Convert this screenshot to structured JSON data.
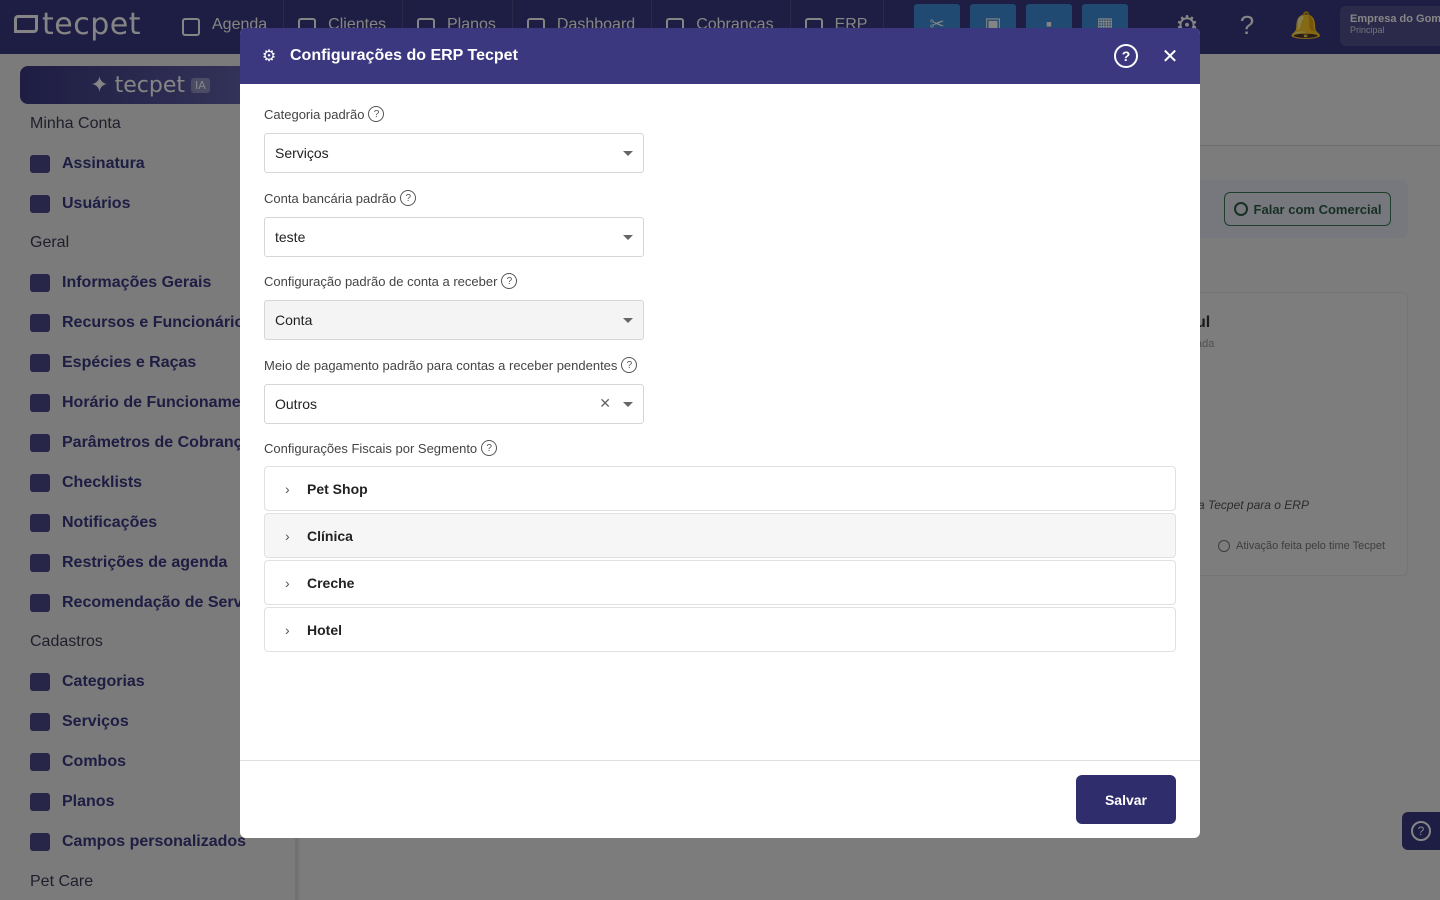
{
  "app": {
    "logo": "tecpet",
    "ia_label": "tecpet",
    "ia_tag": "IA"
  },
  "topnav": [
    "Agenda",
    "Clientes",
    "Planos",
    "Dashboard",
    "Cobranças",
    "ERP"
  ],
  "company": {
    "name": "Empresa do Gomes",
    "role": "Principal"
  },
  "sidebar": {
    "sections": [
      "Minha Conta",
      "Geral",
      "Cadastros",
      "Pet Care"
    ],
    "items": [
      "Assinatura",
      "Usuários",
      "Informações Gerais",
      "Recursos e Funcionários",
      "Espécies e Raças",
      "Horário de Funcionamento",
      "Parâmetros de Cobrança",
      "Checklists",
      "Notificações",
      "Restrições de agenda",
      "Recomendação de Serviços",
      "Categorias",
      "Serviços",
      "Combos",
      "Planos",
      "Campos personalizados"
    ]
  },
  "background": {
    "whatsapp_button": "Falar com Comercial",
    "card_title": "ul",
    "card_subtitle": "ada",
    "card_link": "a Tecpet para o ERP",
    "card_footer": "Ativação feita pelo time Tecpet"
  },
  "modal": {
    "title": "Configurações do ERP Tecpet",
    "fields": [
      {
        "label": "Categoria padrão",
        "value": "Serviços"
      },
      {
        "label": "Conta bancária padrão",
        "value": "teste"
      },
      {
        "label": "Configuração padrão de conta a receber",
        "value": "Conta"
      },
      {
        "label": "Meio de pagamento padrão para contas a receber pendentes",
        "value": "Outros"
      }
    ],
    "segment_label": "Configurações Fiscais por Segmento",
    "segments": [
      "Pet Shop",
      "Clínica",
      "Creche",
      "Hotel"
    ],
    "save_label": "Salvar"
  },
  "colors": {
    "primary": "#3b3880",
    "save": "#2f2d6b",
    "quick_action": "#3f8ed8"
  }
}
